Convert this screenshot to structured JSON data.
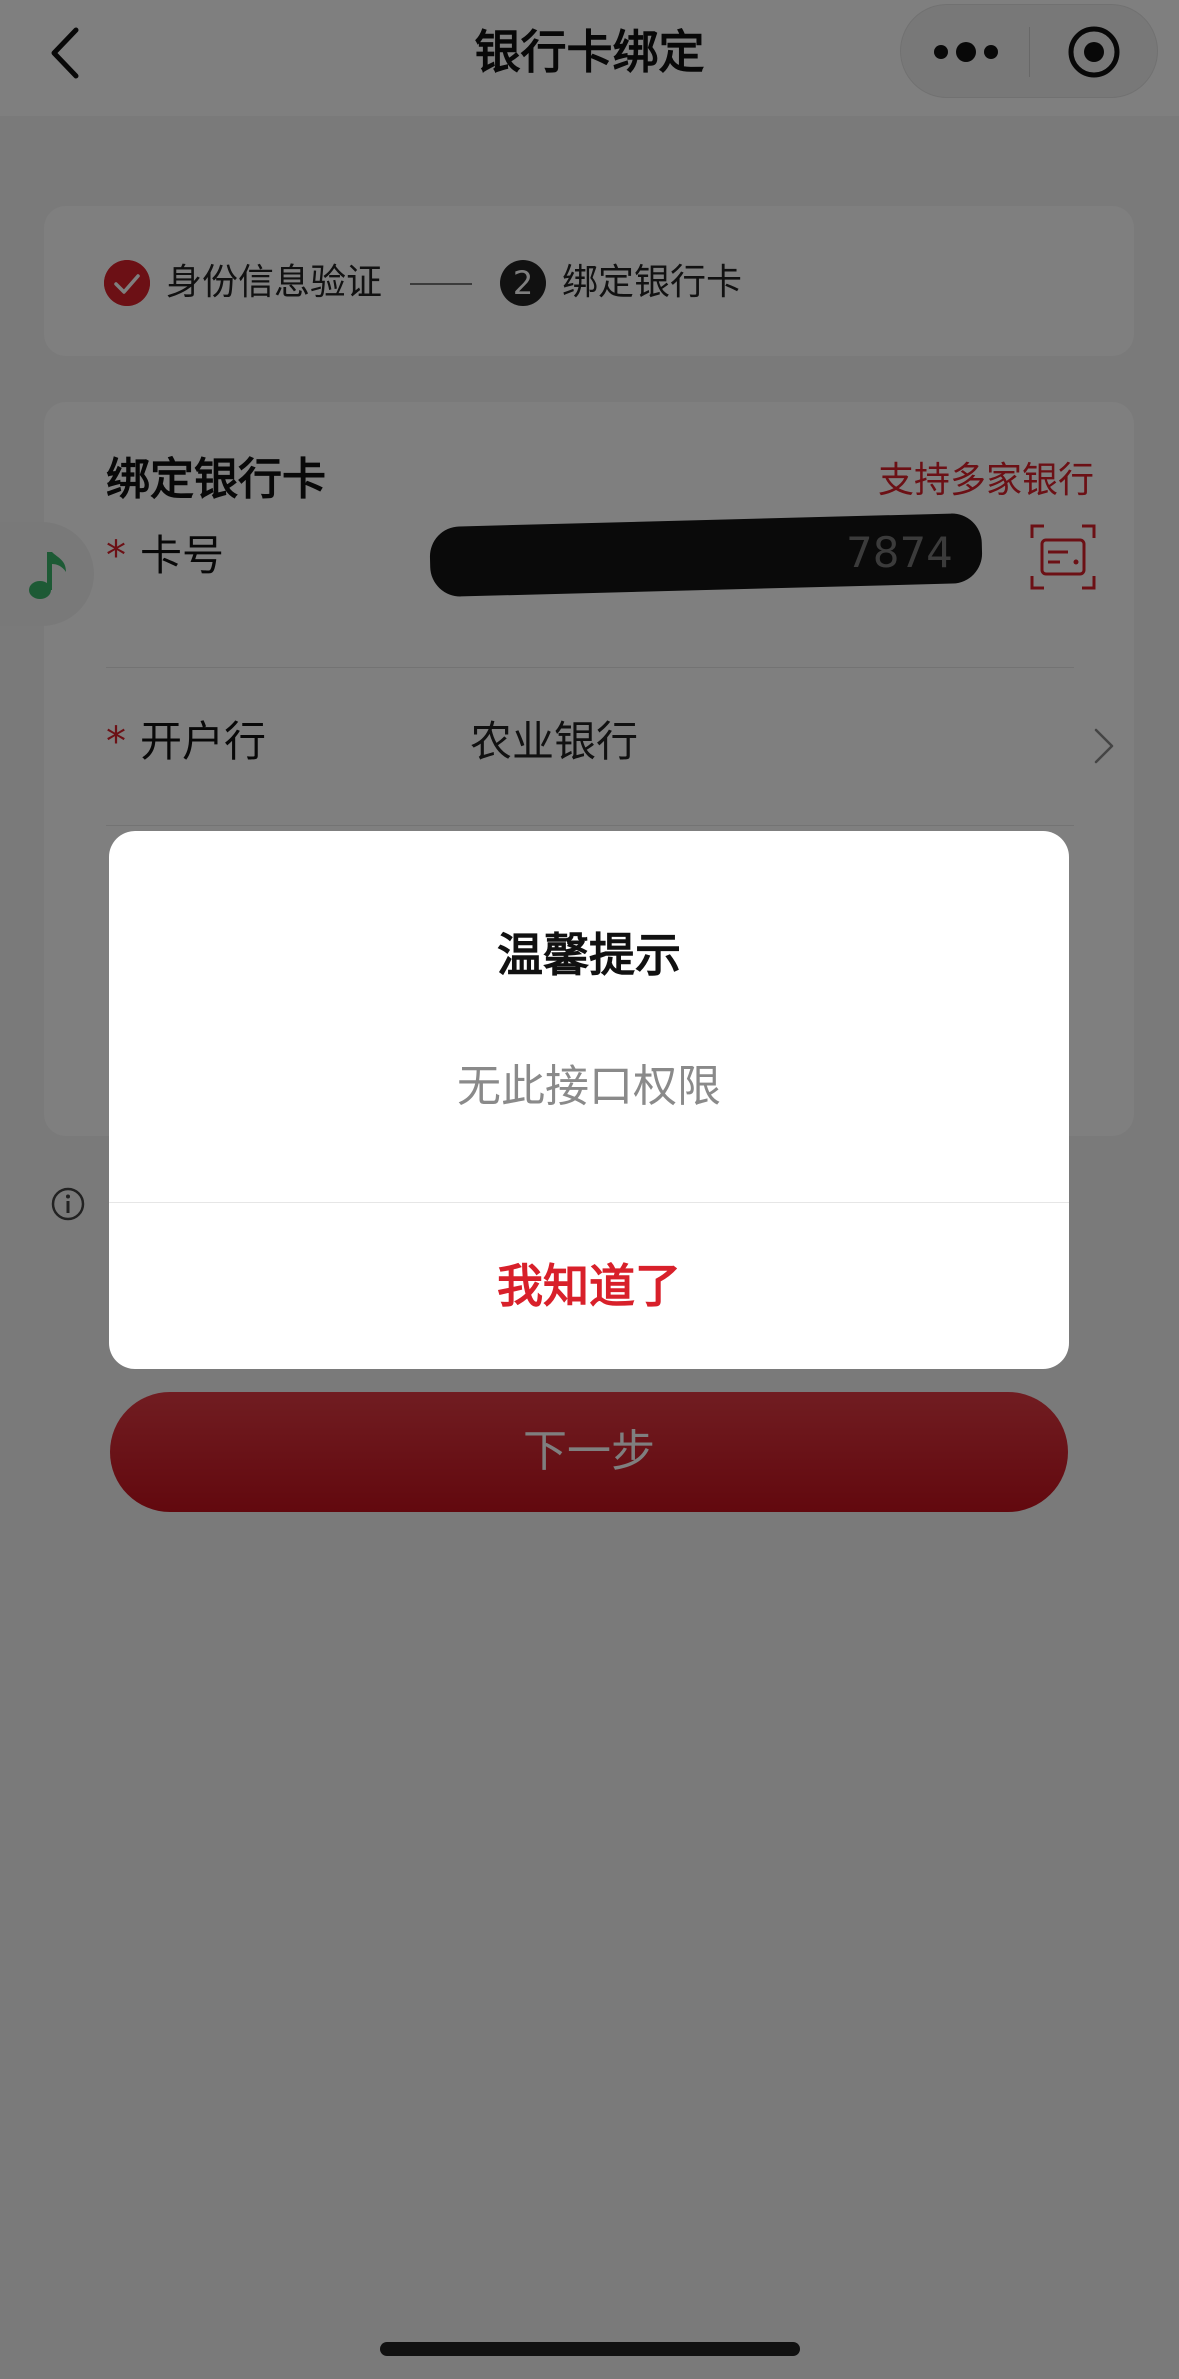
{
  "nav": {
    "title": "银行卡绑定",
    "back_icon": "chevron-left-icon",
    "more_icon": "more-dots-icon",
    "close_icon": "target-close-icon"
  },
  "steps": {
    "step1_label": "身份信息验证",
    "step2_number": "2",
    "step2_label": "绑定银行卡"
  },
  "form": {
    "title": "绑定银行卡",
    "support_link": "支持多家银行",
    "card_number": {
      "required_mark": "*",
      "label": "卡号",
      "visible_tail": "7874",
      "scan_icon": "card-scan-icon"
    },
    "bank": {
      "required_mark": "*",
      "label": "开户行",
      "value": "农业银行",
      "chevron_icon": "chevron-right-icon"
    }
  },
  "next_button": "下一步",
  "dialog": {
    "title": "温馨提示",
    "message": "无此接口权限",
    "confirm": "我知道了"
  },
  "colors": {
    "accent_red": "#d8202a",
    "music_green": "#3ab56a"
  }
}
